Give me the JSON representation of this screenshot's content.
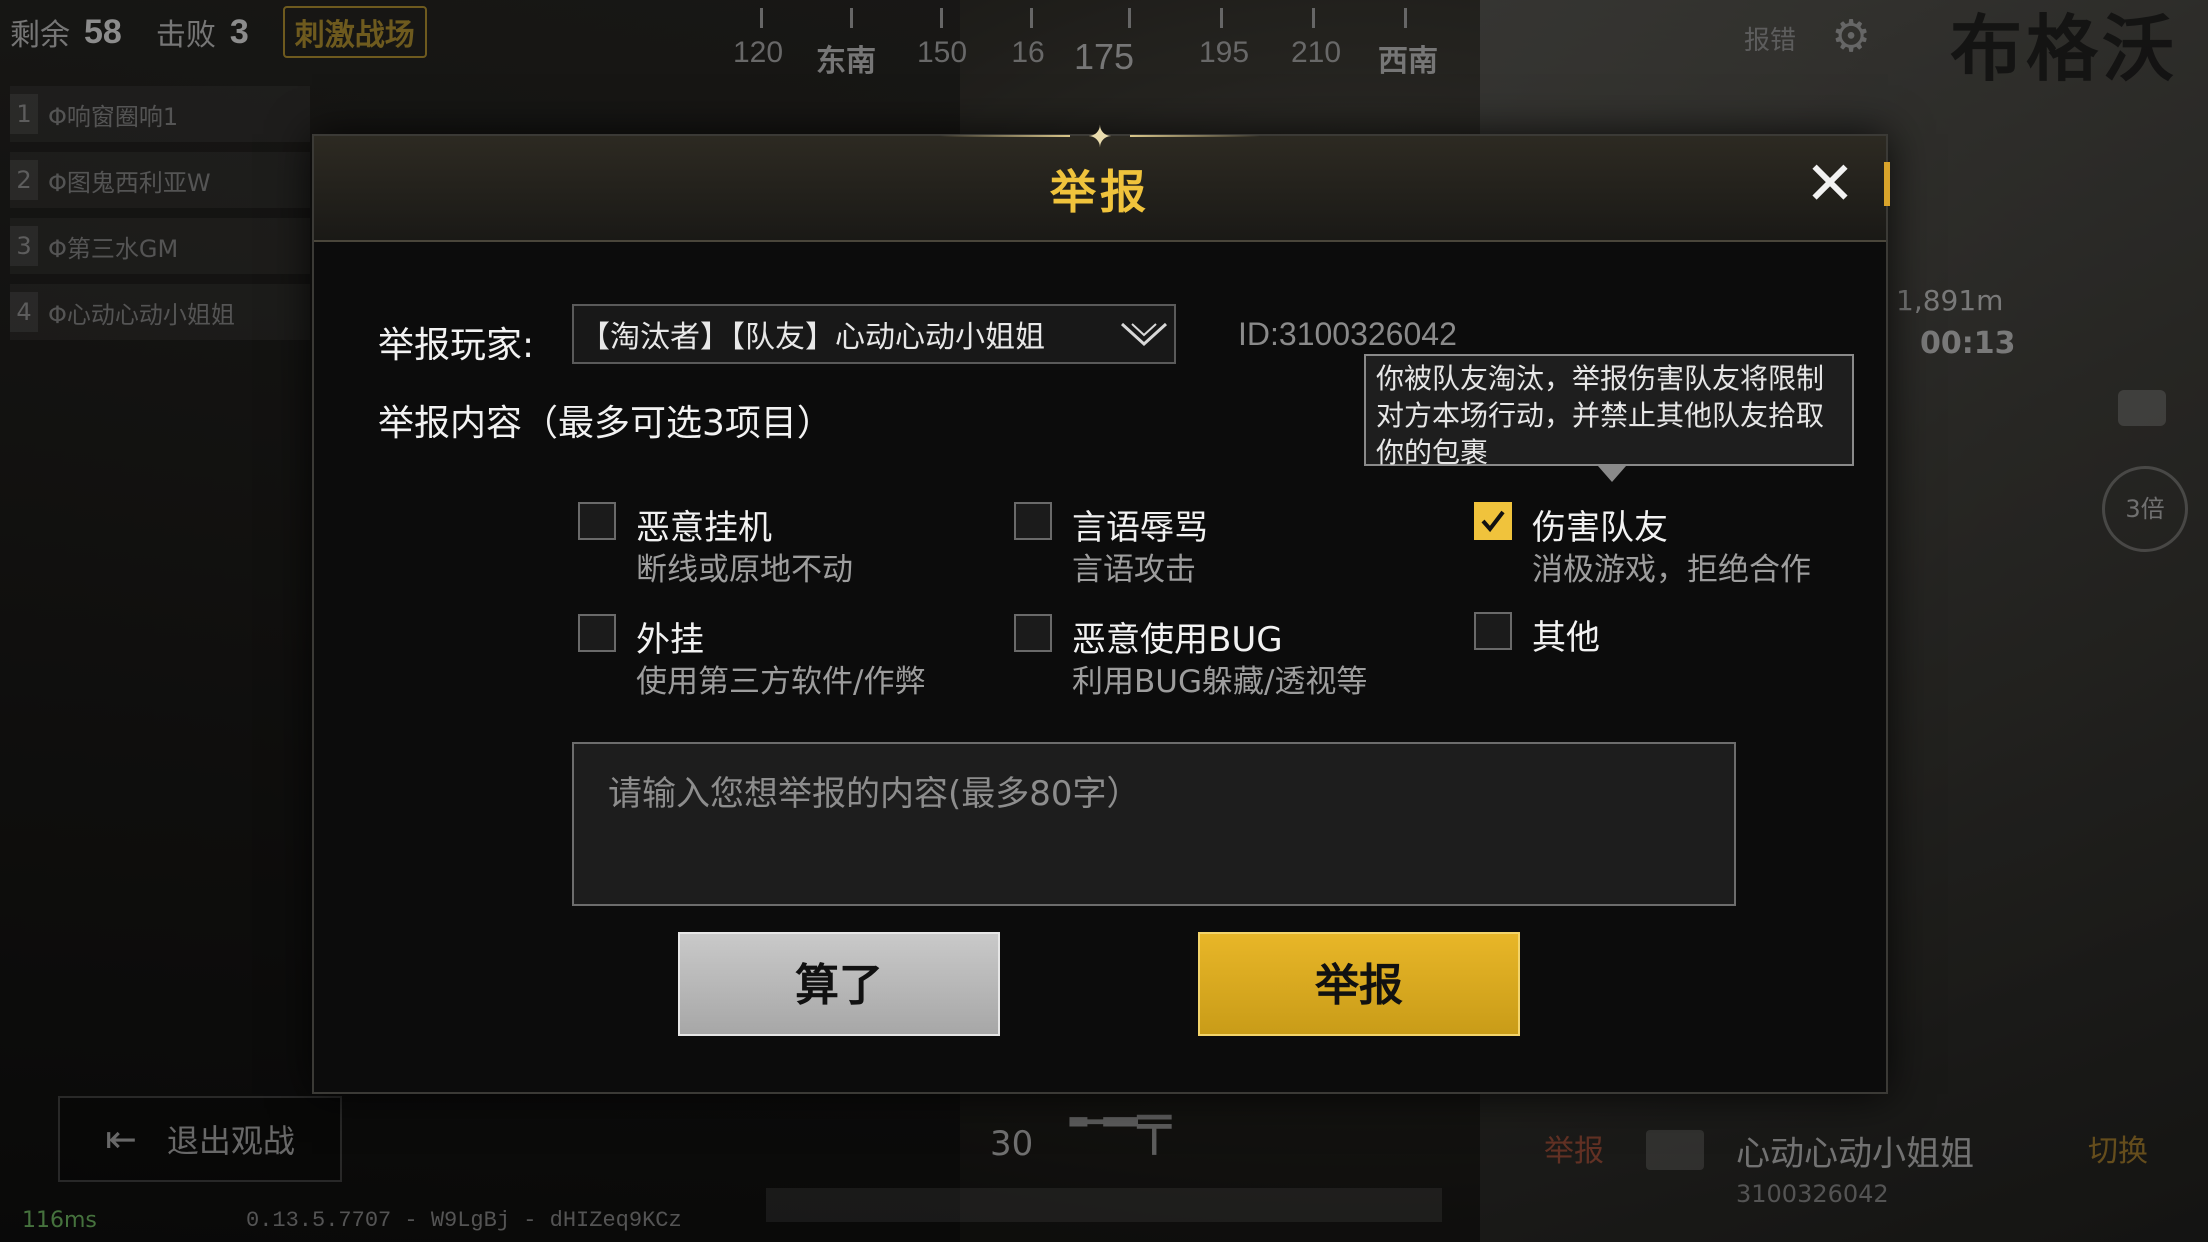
{
  "hud": {
    "remaining_label": "剩余",
    "remaining_value": "58",
    "kills_label": "击败",
    "kills_value": "3",
    "mode_badge": "刺激战场",
    "error_report": "报错",
    "map_text": "布格沃",
    "distance": "1,891m",
    "timer": "00:13",
    "scope": "3倍",
    "exit_spectate": "退出观战",
    "ping": "116ms",
    "version": "0.13.5.7707 - W9LgBj - dHIZeq9KCz",
    "ammo": "30"
  },
  "squad": [
    {
      "index": "1",
      "name": "Φ响窗圈响1"
    },
    {
      "index": "2",
      "name": "Φ图鬼西利亚W"
    },
    {
      "index": "3",
      "name": "Φ第三水GM"
    },
    {
      "index": "4",
      "name": "Φ心动心动小姐姐"
    }
  ],
  "compass": {
    "labels": [
      {
        "text": "120",
        "kind": "num"
      },
      {
        "text": "东南",
        "kind": "dir"
      },
      {
        "text": "150",
        "kind": "num"
      },
      {
        "text": "16",
        "kind": "num"
      },
      {
        "text": "175",
        "kind": "big"
      },
      {
        "text": "195",
        "kind": "num"
      },
      {
        "text": "210",
        "kind": "num"
      },
      {
        "text": "西南",
        "kind": "dir"
      }
    ]
  },
  "spectate": {
    "report": "举报",
    "name": "心动心动小姐姐",
    "id": "3100326042",
    "switch": "切换"
  },
  "dialog": {
    "title": "举报",
    "player_label": "举报玩家:",
    "player_value": "【淘汰者】【队友】心动心动小姐姐",
    "player_id": "ID:3100326042",
    "content_label": "举报内容（最多可选3项目）",
    "tooltip": "你被队友淘汰，举报伤害队友将限制对方本场行动，并禁止其他队友拾取你的包裹",
    "options": [
      {
        "title": "恶意挂机",
        "sub": "断线或原地不动",
        "checked": false
      },
      {
        "title": "言语辱骂",
        "sub": "言语攻击",
        "checked": false
      },
      {
        "title": "伤害队友",
        "sub": "消极游戏，拒绝合作",
        "checked": true
      },
      {
        "title": "外挂",
        "sub": "使用第三方软件/作弊",
        "checked": false
      },
      {
        "title": "恶意使用BUG",
        "sub": "利用BUG躲藏/透视等",
        "checked": false
      },
      {
        "title": "其他",
        "sub": "",
        "checked": false
      }
    ],
    "textarea_placeholder": "请输入您想举报的内容(最多80字）",
    "cancel_label": "算了",
    "submit_label": "举报"
  },
  "colors": {
    "accent_gold": "#f0c33c",
    "cancel_gray": "#b8b8b8"
  }
}
